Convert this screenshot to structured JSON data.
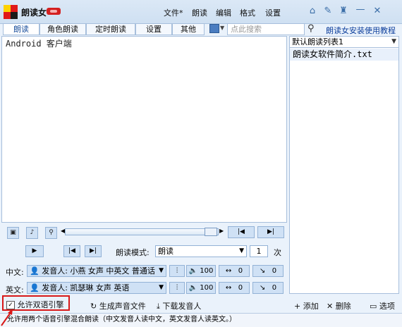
{
  "app": {
    "title": "朗读女"
  },
  "menu": [
    "文件*",
    "朗读",
    "编辑",
    "格式",
    "设置"
  ],
  "toolbar_icons": [
    "home-icon",
    "pin-icon",
    "shirt-icon",
    "minimize-icon",
    "close-icon"
  ],
  "tabs": [
    {
      "label": "朗读",
      "active": true
    },
    {
      "label": "角色朗读"
    },
    {
      "label": "定时朗读"
    },
    {
      "label": "设置"
    },
    {
      "label": "其他"
    }
  ],
  "search": {
    "placeholder": "点此搜索"
  },
  "help_link": "朗读女安装使用教程",
  "editor": {
    "text": "Android 客户端"
  },
  "playlist": {
    "selected": "默认朗读列表1",
    "items": [
      "朗读女软件简介.txt"
    ]
  },
  "read_mode": {
    "label": "朗读模式:",
    "value": "朗读",
    "count": "1",
    "unit": "次"
  },
  "chinese": {
    "label": "中文:",
    "voice": "发音人: 小燕 女声 中英文 普通话",
    "volume": "100",
    "speed": "0",
    "pitch": "0"
  },
  "english": {
    "label": "英文:",
    "voice": "发音人: 凯瑟琳 女声 英语",
    "volume": "100",
    "speed": "0",
    "pitch": "0"
  },
  "bottom": {
    "dual_engine": "允许双语引擎",
    "dual_engine_checked": true,
    "generate_audio": "生成声音文件",
    "download_voice": "下载发音人",
    "add": "添加",
    "delete": "删除",
    "options": "选项"
  },
  "status_text": "允许用两个语音引擎混合朗读（中文发音人读中文，英文发音人读英文。）"
}
